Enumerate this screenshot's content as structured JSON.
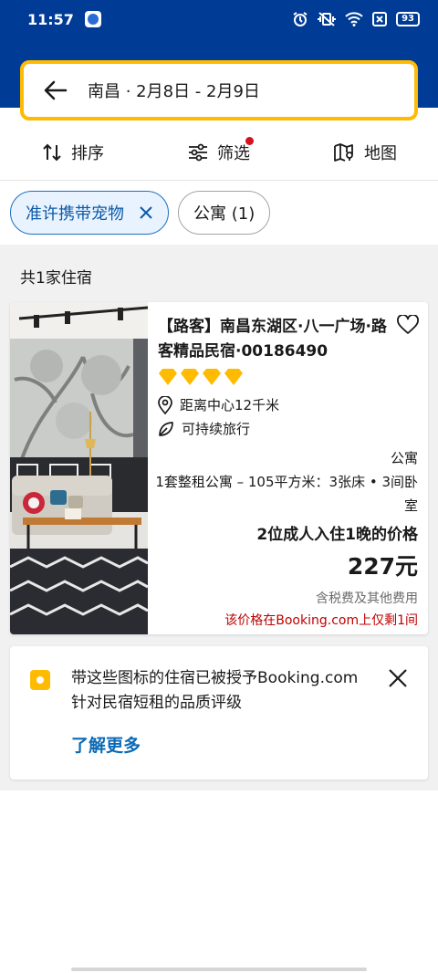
{
  "status_bar": {
    "time": "11:57",
    "battery": "93",
    "icons": [
      "alarm-icon",
      "vibrate-icon",
      "wifi-icon",
      "sim-icon",
      "battery-icon"
    ]
  },
  "search": {
    "text": "南昌 · 2月8日 - 2月9日"
  },
  "toolbar": {
    "sort_label": "排序",
    "filter_label": "筛选",
    "map_label": "地图"
  },
  "chips": {
    "active_label": "准许携带宠物",
    "apartment_label": "公寓 (1)"
  },
  "results": {
    "count_label": "共1家住宿"
  },
  "property": {
    "title": "【路客】南昌东湖区·八一广场·路客精品民宿·00186490",
    "quality_rating": 4,
    "distance": "距离中心12千米",
    "sustainable": "可持续旅行",
    "unit_type": "公寓",
    "unit_desc": "1套整租公寓 – 105平方米：3张床 • 3间卧室",
    "price_label": "2位成人入住1晚的价格",
    "price": "227元",
    "tax_note": "含税费及其他费用",
    "scarcity": "该价格在Booking.com上仅剩1间"
  },
  "info_card": {
    "text": "带这些图标的住宿已被授予Booking.com针对民宿短租的品质评级",
    "link": "了解更多"
  },
  "colors": {
    "brand_blue": "#003b95",
    "accent_yellow": "#febb02",
    "link_blue": "#0a6ab6",
    "alert_red": "#c00000"
  }
}
